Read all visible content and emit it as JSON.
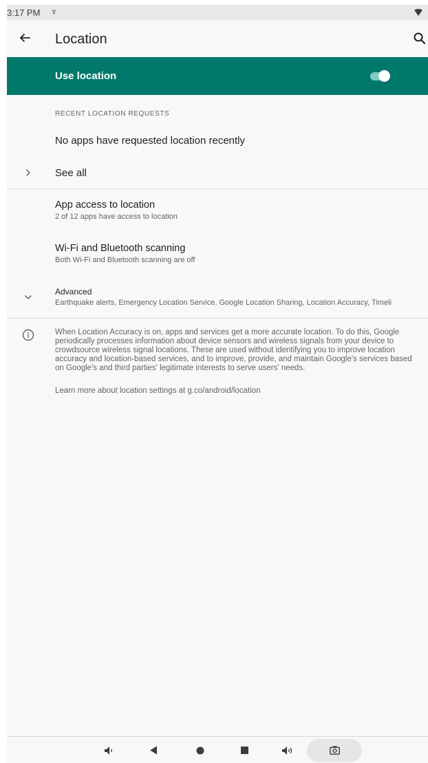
{
  "status_bar": {
    "time": "3:17 PM",
    "usb_symbol": "♆"
  },
  "app_bar": {
    "title": "Location"
  },
  "use_location": {
    "label": "Use location",
    "enabled": true,
    "accent": "#00796b"
  },
  "recent": {
    "header": "RECENT LOCATION REQUESTS",
    "empty_text": "No apps have requested location recently",
    "see_all": "See all"
  },
  "app_access": {
    "title": "App access to location",
    "subtitle": "2 of 12 apps have access to location"
  },
  "scanning": {
    "title": "Wi-Fi and Bluetooth scanning",
    "subtitle": "Both Wi-Fi and Bluetooth scanning are off"
  },
  "advanced": {
    "title": "Advanced",
    "subtitle": "Earthquake alerts, Emergency Location Service, Google Location Sharing, Location Accuracy, Timeli"
  },
  "footer": {
    "info": "When Location Accuracy is on, apps and services get a more accurate location. To do this, Google periodically processes information about device sensors and wireless signals from your device to crowdsource wireless signal locations. These are used without identifying you to improve location accuracy and location-based services, and to improve, provide, and maintain Google's services based on Google's and third parties' legitimate interests to serve users' needs.",
    "learn_more": "Learn more about location settings at g.co/android/location"
  },
  "nav_bar": {
    "icons": [
      "volume-down-icon",
      "back-icon",
      "home-icon",
      "recents-icon",
      "volume-up-icon",
      "screenshot-icon"
    ]
  }
}
